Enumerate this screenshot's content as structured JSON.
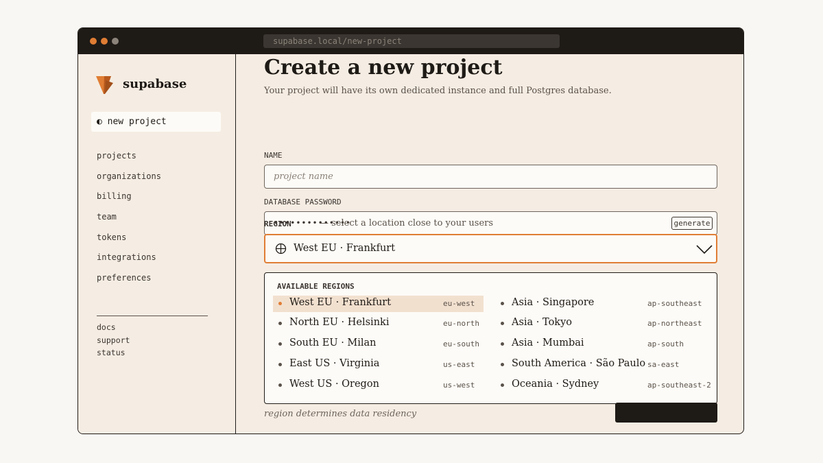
{
  "browser": {
    "url": "supabase.local/new-project"
  },
  "sidebar": {
    "brand": "supabase",
    "new_project": "◐ new project",
    "items": [
      "projects",
      "organizations",
      "billing",
      "team",
      "tokens",
      "integrations",
      "preferences"
    ],
    "footer": [
      "docs",
      "support",
      "status"
    ]
  },
  "main": {
    "title": "Create a new project",
    "subtitle": "Your project will have its own dedicated instance and full Postgres database.",
    "name_label": "NAME",
    "name_placeholder": "project name",
    "password_label": "DATABASE PASSWORD",
    "password_value": "••••••••••••••",
    "generate_label": "generate",
    "region_label": "REGION",
    "region_hint": "— select a location close to your users",
    "region_selected": "West EU · Frankfurt",
    "panel_title": "AVAILABLE REGIONS",
    "regions": [
      {
        "name": "West EU · Frankfurt",
        "code": "eu-west"
      },
      {
        "name": "North EU · Helsinki",
        "code": "eu-north"
      },
      {
        "name": "South EU · Milan",
        "code": "eu-south"
      },
      {
        "name": "East US · Virginia",
        "code": "us-east"
      },
      {
        "name": "West US · Oregon",
        "code": "us-west"
      },
      {
        "name": "Asia · Singapore",
        "code": "ap-southeast"
      },
      {
        "name": "Asia · Tokyo",
        "code": "ap-northeast"
      },
      {
        "name": "Asia · Mumbai",
        "code": "ap-south"
      },
      {
        "name": "South America · São Paulo",
        "code": "sa-east"
      },
      {
        "name": "Oceania · Sydney",
        "code": "ap-southeast-2"
      }
    ],
    "footnote": "region determines data residency"
  },
  "colors": {
    "accent": "#e07d34",
    "ink": "#1e1a16",
    "paper": "#f5ede3",
    "selected_bg": "#f2e0cf"
  }
}
